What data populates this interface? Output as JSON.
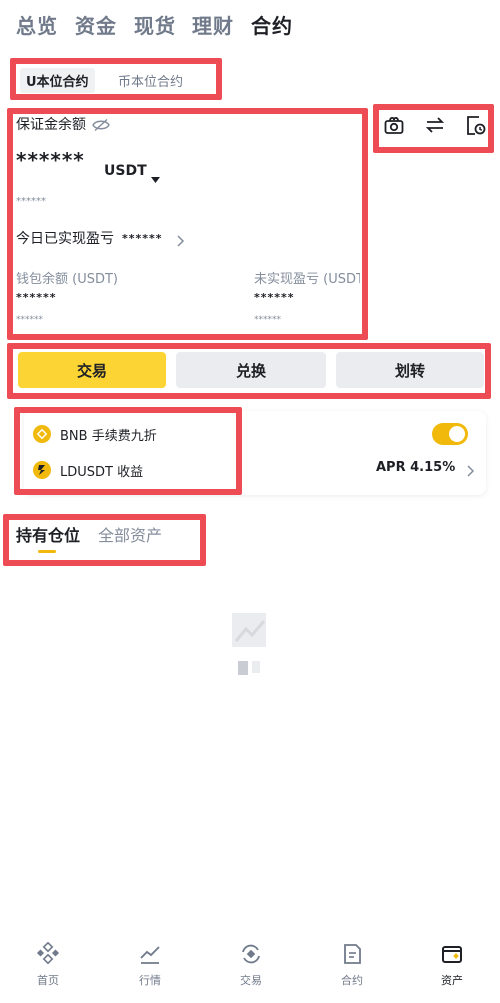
{
  "top_tabs": [
    {
      "label": "总览"
    },
    {
      "label": "资金"
    },
    {
      "label": "现货"
    },
    {
      "label": "理财"
    },
    {
      "label": "合约"
    }
  ],
  "sub_tabs": [
    {
      "label": "U本位合约"
    },
    {
      "label": "币本位合约"
    }
  ],
  "balance": {
    "margin_label": "保证金余额",
    "margin_value": "******",
    "currency": "USDT",
    "fiat_value": "******",
    "realized_label": "今日已实现盈亏",
    "realized_value": "******",
    "wallet_label": "钱包余额 (USDT)",
    "wallet_value": "******",
    "wallet_sub": "******",
    "unrealized_label": "未实现盈亏 (USDT)",
    "unrealized_value": "******",
    "unrealized_sub": "******"
  },
  "header_icons": [
    "gift-icon",
    "transfer-icon",
    "history-icon"
  ],
  "actions": [
    {
      "label": "交易"
    },
    {
      "label": "兑换"
    },
    {
      "label": "划转"
    }
  ],
  "promo": {
    "bnb_label": "BNB 手续费九折",
    "ldusdt_label": "LDUSDT 收益",
    "apr": "APR 4.15%",
    "bnb_toggle_on": true
  },
  "position_tabs": [
    {
      "label": "持有仓位"
    },
    {
      "label": "全部资产"
    }
  ],
  "bottom_nav": [
    {
      "label": "首页",
      "icon": "home-icon"
    },
    {
      "label": "行情",
      "icon": "markets-icon"
    },
    {
      "label": "交易",
      "icon": "trade-icon"
    },
    {
      "label": "合约",
      "icon": "futures-icon"
    },
    {
      "label": "资产",
      "icon": "wallet-icon"
    }
  ],
  "colors": {
    "accent": "#fcd535",
    "highlight_border": "#ee4c55",
    "muted_text": "#848e9c"
  }
}
